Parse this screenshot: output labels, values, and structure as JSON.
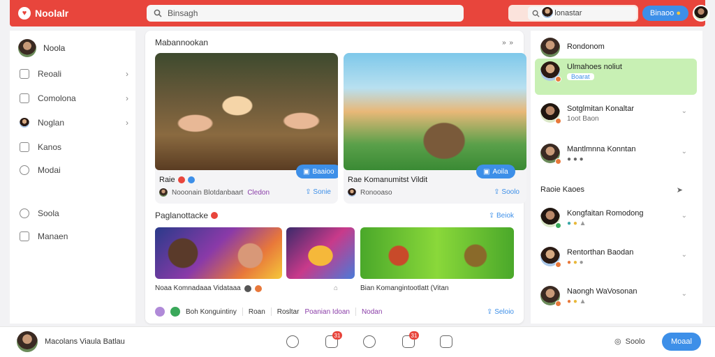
{
  "app": {
    "name": "Noolalr",
    "logo_icon": "heart-icon"
  },
  "search": {
    "text": "Binsagh",
    "icon": "search-icon"
  },
  "search_secondary": {
    "text": "Molonastar",
    "icon": "search-icon"
  },
  "header": {
    "button_label": "Binaoo"
  },
  "colors": {
    "brand": "#e8453c",
    "accent": "#3d8fe8",
    "active_bg": "#c8f0b4"
  },
  "sidebar": {
    "profile_name": "Noola",
    "items": [
      {
        "label": "Reoali",
        "icon": "image-icon"
      },
      {
        "label": "Comolona",
        "icon": "calendar-icon"
      },
      {
        "label": "Noglan",
        "icon": "avatar-icon"
      },
      {
        "label": "Kanos",
        "icon": "store-icon"
      },
      {
        "label": "Modai",
        "icon": "clock-icon"
      },
      {
        "label": "Soola",
        "icon": "compass-icon"
      },
      {
        "label": "Manaen",
        "icon": "bag-icon"
      }
    ]
  },
  "feed": {
    "section_title": "Mabannookan",
    "more": "» »",
    "cards": [
      {
        "title": "Raie",
        "button": "Baaioo",
        "meta": "Nooonain Blotdanbaart",
        "meta_highlight": "Cledon",
        "share": "Sonie"
      },
      {
        "title": "Rae Komanumitst Vildit",
        "button": "Aoila",
        "meta": "Ronooaso",
        "share": "Soolo"
      }
    ],
    "section2_title": "Paglanottacke",
    "section2_share": "Beiok",
    "thumbs": [
      {
        "caption": "Noaa Komnadaaa Vidataaa"
      },
      {
        "caption": ""
      },
      {
        "caption": "Bian Komangintootlatt (Vitan"
      }
    ],
    "bottom_row": {
      "a": "Boh Konguintiny",
      "b": "Roan",
      "c": "Rosltar",
      "d": "Poanian Idoan",
      "e": "Nodan",
      "share": "Seloio"
    }
  },
  "right_panel": {
    "header": "Rondonom",
    "active": {
      "name": "Ulmahoes noliut",
      "tag": "Boarat"
    },
    "items": [
      {
        "name": "Sotglmitan Konaltar",
        "sub": "1oot Baon"
      },
      {
        "name": "Mantlmnna Konntan",
        "sub": ""
      }
    ],
    "section": "Raoie Kaoes",
    "people": [
      {
        "name": "Kongfaitan Romodong"
      },
      {
        "name": "Rentorthan Baodan"
      },
      {
        "name": "Naongh WaVosonan"
      }
    ]
  },
  "bottom_bar": {
    "profile_name": "Macolans Viaula Batlau",
    "counts": [
      "31",
      "31"
    ],
    "help_label": "Soolo",
    "button_label": "Moaal"
  }
}
